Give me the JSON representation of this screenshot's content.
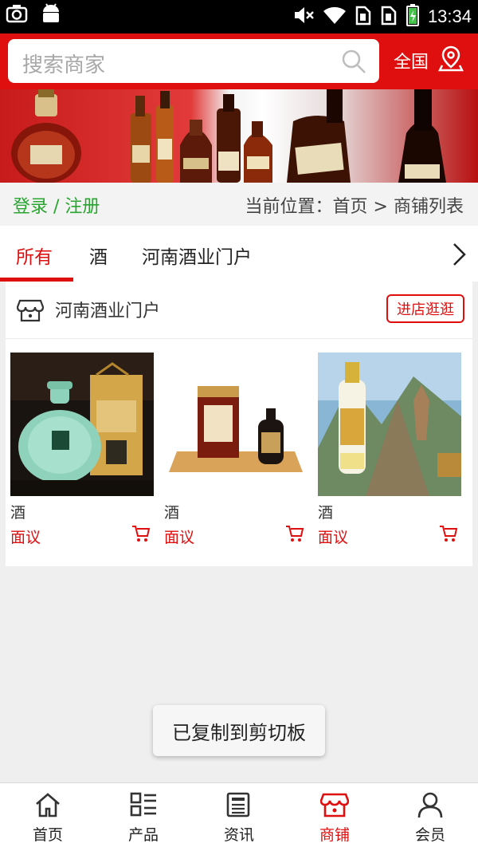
{
  "status_bar": {
    "time": "13:34",
    "icons": [
      "camera-icon",
      "android-icon",
      "mute-icon",
      "wifi-icon",
      "sim-icon",
      "sim-icon",
      "battery-icon"
    ]
  },
  "header": {
    "search_placeholder": "搜索商家",
    "region_label": "全国",
    "brand_color": "#e00f0f"
  },
  "breadcrumb": {
    "login": "登录",
    "separator": " / ",
    "register": "注册",
    "location_prefix": "当前位置：",
    "home": "首页",
    "arrow": " > ",
    "current": "商铺列表"
  },
  "tabs": [
    {
      "label": "所有",
      "active": true
    },
    {
      "label": "酒",
      "active": false
    },
    {
      "label": "河南酒业门户",
      "active": false
    }
  ],
  "store": {
    "name": "河南酒业门户",
    "enter_label": "进店逛逛",
    "products": [
      {
        "name": "酒",
        "price": "面议",
        "image": "jade-green-liquor-jar-with-gift-box"
      },
      {
        "name": "酒",
        "price": "面议",
        "image": "dark-bottle-with-wooden-box"
      },
      {
        "name": "酒",
        "price": "面议",
        "image": "clear-baijiu-bottle-mountain-scene"
      }
    ]
  },
  "toast": "已复制到剪切板",
  "bottom_nav": [
    {
      "label": "首页",
      "icon": "home-icon",
      "active": false
    },
    {
      "label": "产品",
      "icon": "grid-list-icon",
      "active": false
    },
    {
      "label": "资讯",
      "icon": "news-icon",
      "active": false
    },
    {
      "label": "商铺",
      "icon": "shop-icon",
      "active": true
    },
    {
      "label": "会员",
      "icon": "user-icon",
      "active": false
    }
  ]
}
